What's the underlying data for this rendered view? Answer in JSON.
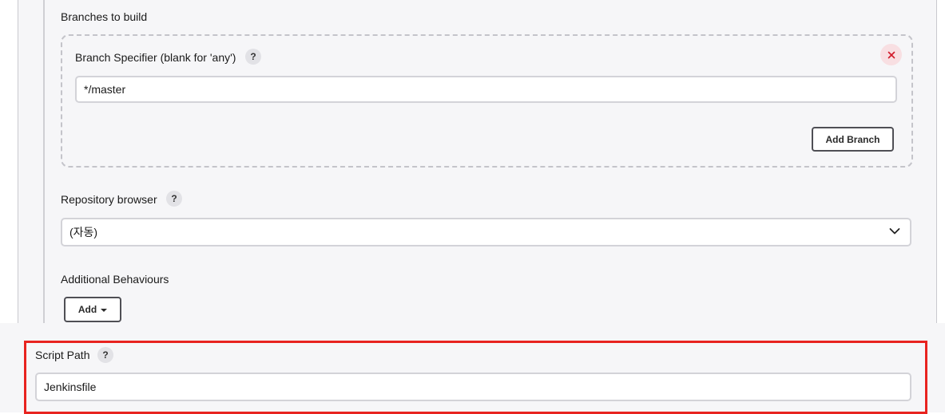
{
  "branches_section": {
    "title": "Branches to build",
    "branch_specifier": {
      "label": "Branch Specifier (blank for 'any')",
      "help": "?",
      "value": "*/master",
      "remove_icon": "close-icon"
    },
    "add_branch_label": "Add Branch"
  },
  "repository_browser": {
    "label": "Repository browser",
    "help": "?",
    "selected": "(자동)",
    "dropdown_icon": "chevron-down-icon"
  },
  "additional_behaviours": {
    "label": "Additional Behaviours",
    "add_label": "Add"
  },
  "script_path": {
    "label": "Script Path",
    "help": "?",
    "value": "Jenkinsfile"
  },
  "colors": {
    "highlight": "#e8231f",
    "remove_icon": "#d11a2a",
    "panel_bg": "#f6f6f8"
  }
}
